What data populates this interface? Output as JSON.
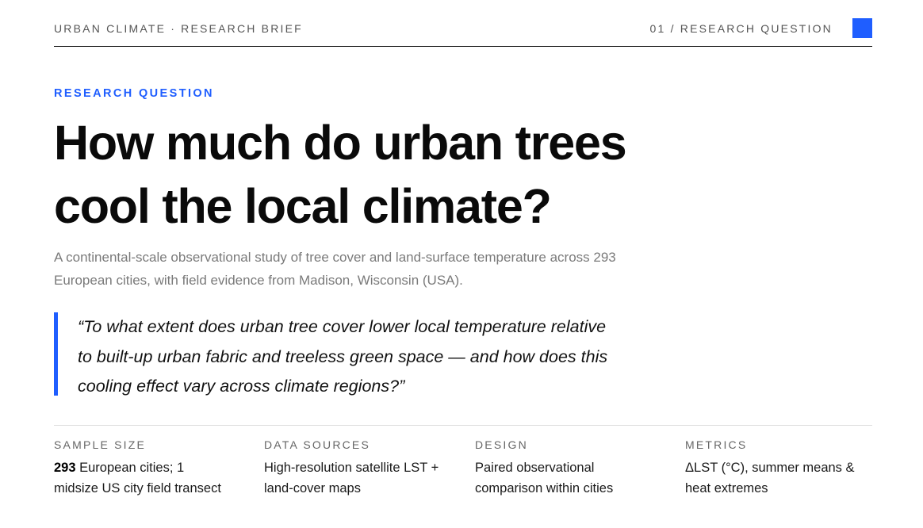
{
  "header": {
    "brand": "URBAN CLIMATE · RESEARCH BRIEF",
    "section": "01 / RESEARCH QUESTION",
    "accent_color": "#1f5eff"
  },
  "eyebrow": "RESEARCH QUESTION",
  "title": {
    "line1": "How much do urban trees",
    "line2": "cool the local climate?"
  },
  "lede": {
    "line1": "A continental-scale observational study of tree cover and land-surface temperature across 293",
    "line2": "European cities, with field evidence from Madison, Wisconsin (USA)."
  },
  "quote": {
    "line1": "“To what extent does urban tree cover lower local temperature relative",
    "line2": "to built-up urban fabric and treeless green space — and how does this",
    "line3": "cooling effect vary across climate regions?”"
  },
  "facts": [
    {
      "label": "SAMPLE SIZE",
      "value_strong": "293",
      "value_line1": " European cities; 1",
      "value_line2": "midsize US city field transect"
    },
    {
      "label": "DATA SOURCES",
      "value_line1": "High-resolution satellite LST +",
      "value_line2": "land-cover maps"
    },
    {
      "label": "DESIGN",
      "value_line1": "Paired observational",
      "value_line2": "comparison within cities"
    },
    {
      "label": "METRICS",
      "value_line1": "ΔLST (°C), summer means &",
      "value_line2": "heat extremes"
    }
  ]
}
